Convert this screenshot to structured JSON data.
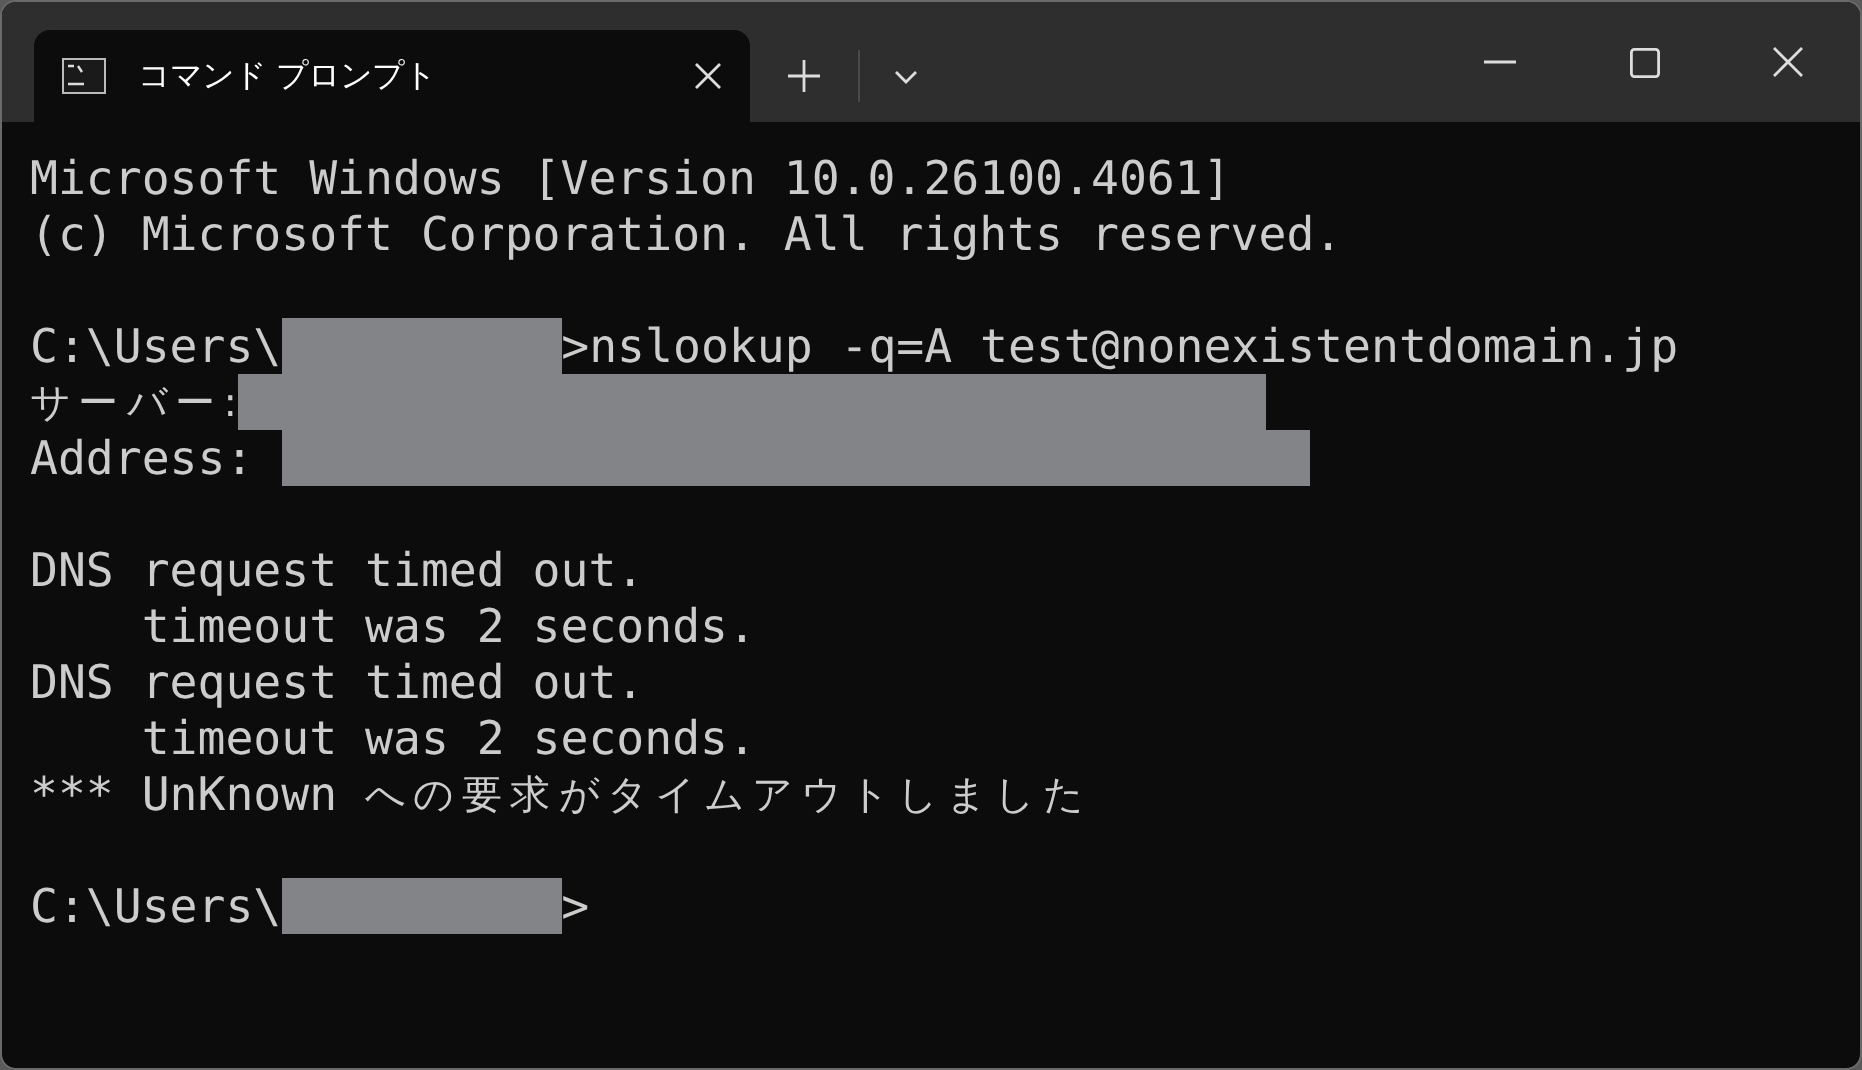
{
  "tabs": [
    {
      "title": "コマンド プロンプト",
      "selected": true
    }
  ],
  "terminal": {
    "lines": [
      [
        {
          "kind": "text",
          "text": "Microsoft Windows [Version 10.0.26100.4061]"
        }
      ],
      [
        {
          "kind": "text",
          "text": "(c) Microsoft Corporation. All rights reserved."
        }
      ],
      [
        {
          "kind": "blank"
        }
      ],
      [
        {
          "kind": "text",
          "text": "C:\\Users\\"
        },
        {
          "kind": "redacted-short"
        },
        {
          "kind": "text",
          "text": ">nslookup -q=A test@nonexistentdomain.jp"
        }
      ],
      [
        {
          "kind": "wide",
          "text": "サーバー:"
        },
        {
          "kind": "redacted-long"
        }
      ],
      [
        {
          "kind": "text",
          "text": "Address: "
        },
        {
          "kind": "redacted-long"
        }
      ],
      [
        {
          "kind": "blank"
        }
      ],
      [
        {
          "kind": "text",
          "text": "DNS request timed out."
        }
      ],
      [
        {
          "kind": "text",
          "text": "    timeout was 2 seconds."
        }
      ],
      [
        {
          "kind": "text",
          "text": "DNS request timed out."
        }
      ],
      [
        {
          "kind": "text",
          "text": "    timeout was 2 seconds."
        }
      ],
      [
        {
          "kind": "text",
          "text": "*** UnKnown "
        },
        {
          "kind": "wide",
          "text": "への要求がタイムアウトしました"
        }
      ],
      [
        {
          "kind": "blank"
        }
      ],
      [
        {
          "kind": "text",
          "text": "C:\\Users\\"
        },
        {
          "kind": "redacted-short"
        },
        {
          "kind": "text",
          "text": ">"
        }
      ]
    ]
  }
}
